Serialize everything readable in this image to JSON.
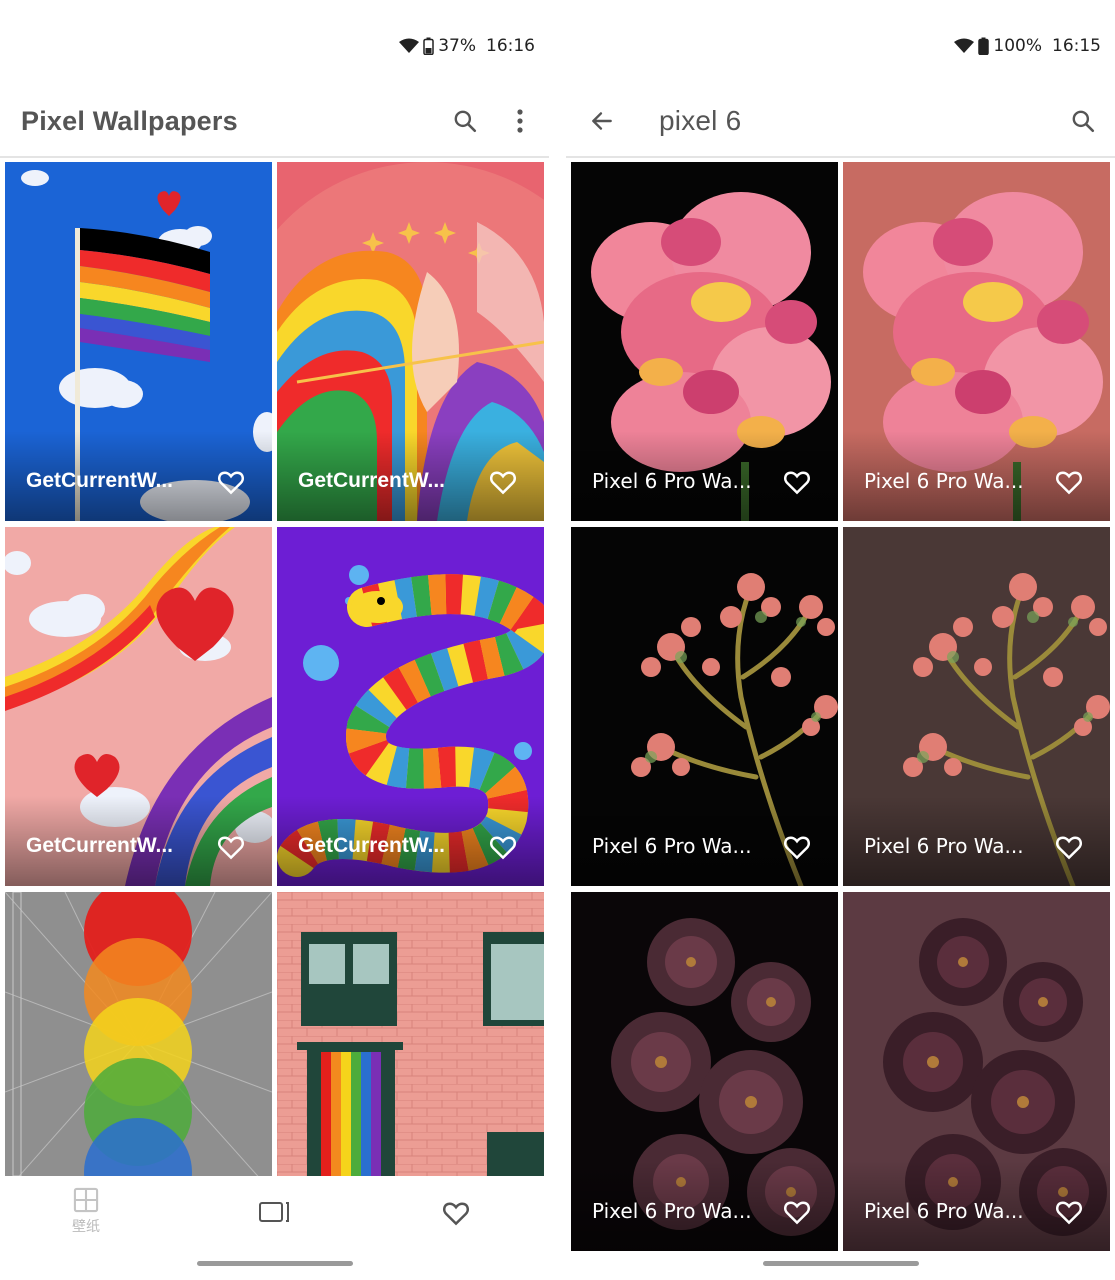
{
  "left": {
    "status": {
      "battery": "37%",
      "time": "16:16"
    },
    "title": "Pixel Wallpapers",
    "tiles": [
      {
        "label": "GetCurrentW..."
      },
      {
        "label": "GetCurrentW..."
      },
      {
        "label": "GetCurrentW..."
      },
      {
        "label": "GetCurrentW..."
      },
      {
        "label": ""
      },
      {
        "label": ""
      }
    ],
    "nav": {
      "wallpapers_label": "壁纸"
    }
  },
  "right": {
    "status": {
      "battery": "100%",
      "time": "16:15"
    },
    "query": "pixel 6",
    "tiles": [
      {
        "label": "Pixel 6 Pro Wa..."
      },
      {
        "label": "Pixel 6 Pro Wa..."
      },
      {
        "label": "Pixel 6 Pro Wa..."
      },
      {
        "label": "Pixel 6 Pro Wa..."
      },
      {
        "label": "Pixel 6 Pro Wa..."
      },
      {
        "label": "Pixel 6 Pro Wa..."
      }
    ]
  },
  "icons": {
    "wifi": "wifi-icon",
    "battery": "battery-icon",
    "search": "search-icon",
    "more": "more-vert-icon",
    "back": "arrow-back-icon",
    "heart": "heart-outline-icon",
    "grid": "grid-icon",
    "wallpaper_current": "current-wallpaper-icon"
  },
  "colors": {
    "nav_inactive": "#9e9e9e",
    "title_text": "#555555"
  }
}
